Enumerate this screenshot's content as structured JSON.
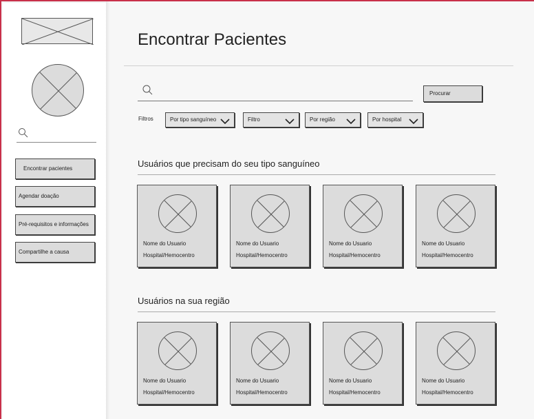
{
  "sidebar": {
    "logo_icon": "image-placeholder-icon",
    "avatar_icon": "avatar-placeholder-icon",
    "search_icon": "search-icon",
    "items": [
      {
        "label": "Encontrar pacientes"
      },
      {
        "label": "Agendar doação"
      },
      {
        "label": "Pré-requisitos e informações"
      },
      {
        "label": "Compartilhe a causa"
      }
    ]
  },
  "main": {
    "title": "Encontrar Pacientes",
    "search": {
      "value": "",
      "button_label": "Procurar"
    },
    "filters": {
      "label": "Filtros",
      "selects": [
        {
          "label": "Por tipo sanguíneo"
        },
        {
          "label": "Filtro"
        },
        {
          "label": "Por região"
        },
        {
          "label": "Por hospital"
        }
      ]
    },
    "sections": [
      {
        "title": "Usuários que precisam do seu tipo sanguíneo",
        "cards": [
          {
            "name": "Nome do Usuario",
            "hospital": "Hospital/Hemocentro"
          },
          {
            "name": "Nome do Usuario",
            "hospital": "Hospital/Hemocentro"
          },
          {
            "name": "Nome do Usuario",
            "hospital": "Hospital/Hemocentro"
          },
          {
            "name": "Nome do Usuario",
            "hospital": "Hospital/Hemocentro"
          }
        ]
      },
      {
        "title": "Usuários na sua região",
        "cards": [
          {
            "name": "Nome do Usuario",
            "hospital": "Hospital/Hemocentro"
          },
          {
            "name": "Nome do Usuario",
            "hospital": "Hospital/Hemocentro"
          },
          {
            "name": "Nome do Usuario",
            "hospital": "Hospital/Hemocentro"
          },
          {
            "name": "Nome do Usuario",
            "hospital": "Hospital/Hemocentro"
          }
        ]
      }
    ]
  },
  "colors": {
    "frame_border": "#c8304a",
    "wireframe_fill": "#dcdcdc",
    "background": "#f7f7f7"
  }
}
